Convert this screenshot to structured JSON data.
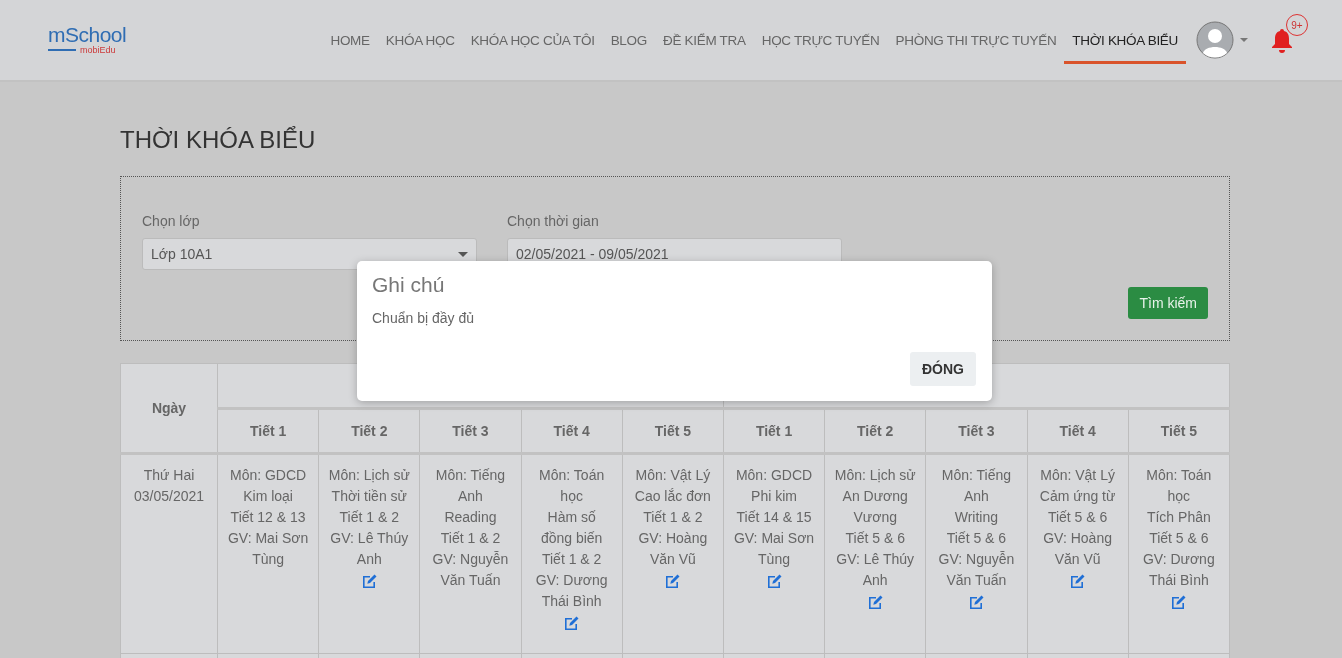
{
  "header": {
    "logo": {
      "brand": "mSchool",
      "sub": "mobiEdu"
    },
    "nav": [
      {
        "label": "HOME",
        "selected": false
      },
      {
        "label": "KHÓA HỌC",
        "selected": false
      },
      {
        "label": "KHÓA HỌC CỦA TÔI",
        "selected": false
      },
      {
        "label": "BLOG",
        "selected": false
      },
      {
        "label": "ĐỀ KIỂM TRA",
        "selected": false
      },
      {
        "label": "HỌC TRỰC TUYẾN",
        "selected": false
      },
      {
        "label": "PHÒNG THI TRỰC TUYẾN",
        "selected": false
      },
      {
        "label": "THỜI KHÓA BIỂU",
        "selected": true
      }
    ],
    "notification_badge": "9+"
  },
  "page_title": "THỜI KHÓA BIỂU",
  "filters": {
    "class_label": "Chọn lớp",
    "class_value": "Lớp 10A1",
    "time_label": "Chọn thời gian",
    "time_value": "02/05/2021 - 09/05/2021",
    "search_button": "Tìm kiếm"
  },
  "table": {
    "day_column": "Ngày",
    "periods": [
      "Tiết 1",
      "Tiết 2",
      "Tiết 3",
      "Tiết 4",
      "Tiết 5",
      "Tiết 1",
      "Tiết 2",
      "Tiết 3",
      "Tiết 4",
      "Tiết 5"
    ],
    "rows": [
      {
        "day": "Thứ Hai",
        "date": "03/05/2021",
        "cells": [
          {
            "lines": [
              "Môn: GDCD",
              "Kim loại",
              "Tiết 12 & 13",
              "GV: Mai Sơn Tùng"
            ],
            "has_note": false
          },
          {
            "lines": [
              "Môn: Lịch sử",
              "Thời tiền sử",
              "Tiết 1 & 2",
              "GV: Lê Thúy Anh"
            ],
            "has_note": true
          },
          {
            "lines": [
              "Môn: Tiếng Anh",
              "Reading",
              "Tiết 1 & 2",
              "GV: Nguyễn Văn Tuấn"
            ],
            "has_note": false
          },
          {
            "lines": [
              "Môn: Toán học",
              "Hàm số đồng biến",
              "Tiết 1 & 2",
              "GV: Dương Thái Bình"
            ],
            "has_note": true
          },
          {
            "lines": [
              "Môn: Vật Lý",
              "Cao lắc đơn",
              "Tiết 1 & 2",
              "GV: Hoàng Văn Vũ"
            ],
            "has_note": true
          },
          {
            "lines": [
              "Môn: GDCD",
              "Phi kim",
              "Tiết 14 & 15",
              "GV: Mai Sơn Tùng"
            ],
            "has_note": true
          },
          {
            "lines": [
              "Môn: Lịch sử",
              "An Dương Vương",
              "Tiết 5 & 6",
              "GV: Lê Thúy Anh"
            ],
            "has_note": true
          },
          {
            "lines": [
              "Môn: Tiếng Anh",
              "Writing",
              "Tiết 5 & 6",
              "GV: Nguyễn Văn Tuấn"
            ],
            "has_note": true
          },
          {
            "lines": [
              "Môn: Vật Lý",
              "Cảm ứng từ",
              "Tiết 5 & 6",
              "GV: Hoàng Văn Vũ"
            ],
            "has_note": true
          },
          {
            "lines": [
              "Môn: Toán học",
              "Tích Phân",
              "Tiết 5 & 6",
              "GV: Dương Thái Bình"
            ],
            "has_note": true
          }
        ]
      }
    ]
  },
  "modal": {
    "title": "Ghi chú",
    "body": "Chuẩn bị đầy đủ",
    "close_button": "ĐÓNG"
  }
}
